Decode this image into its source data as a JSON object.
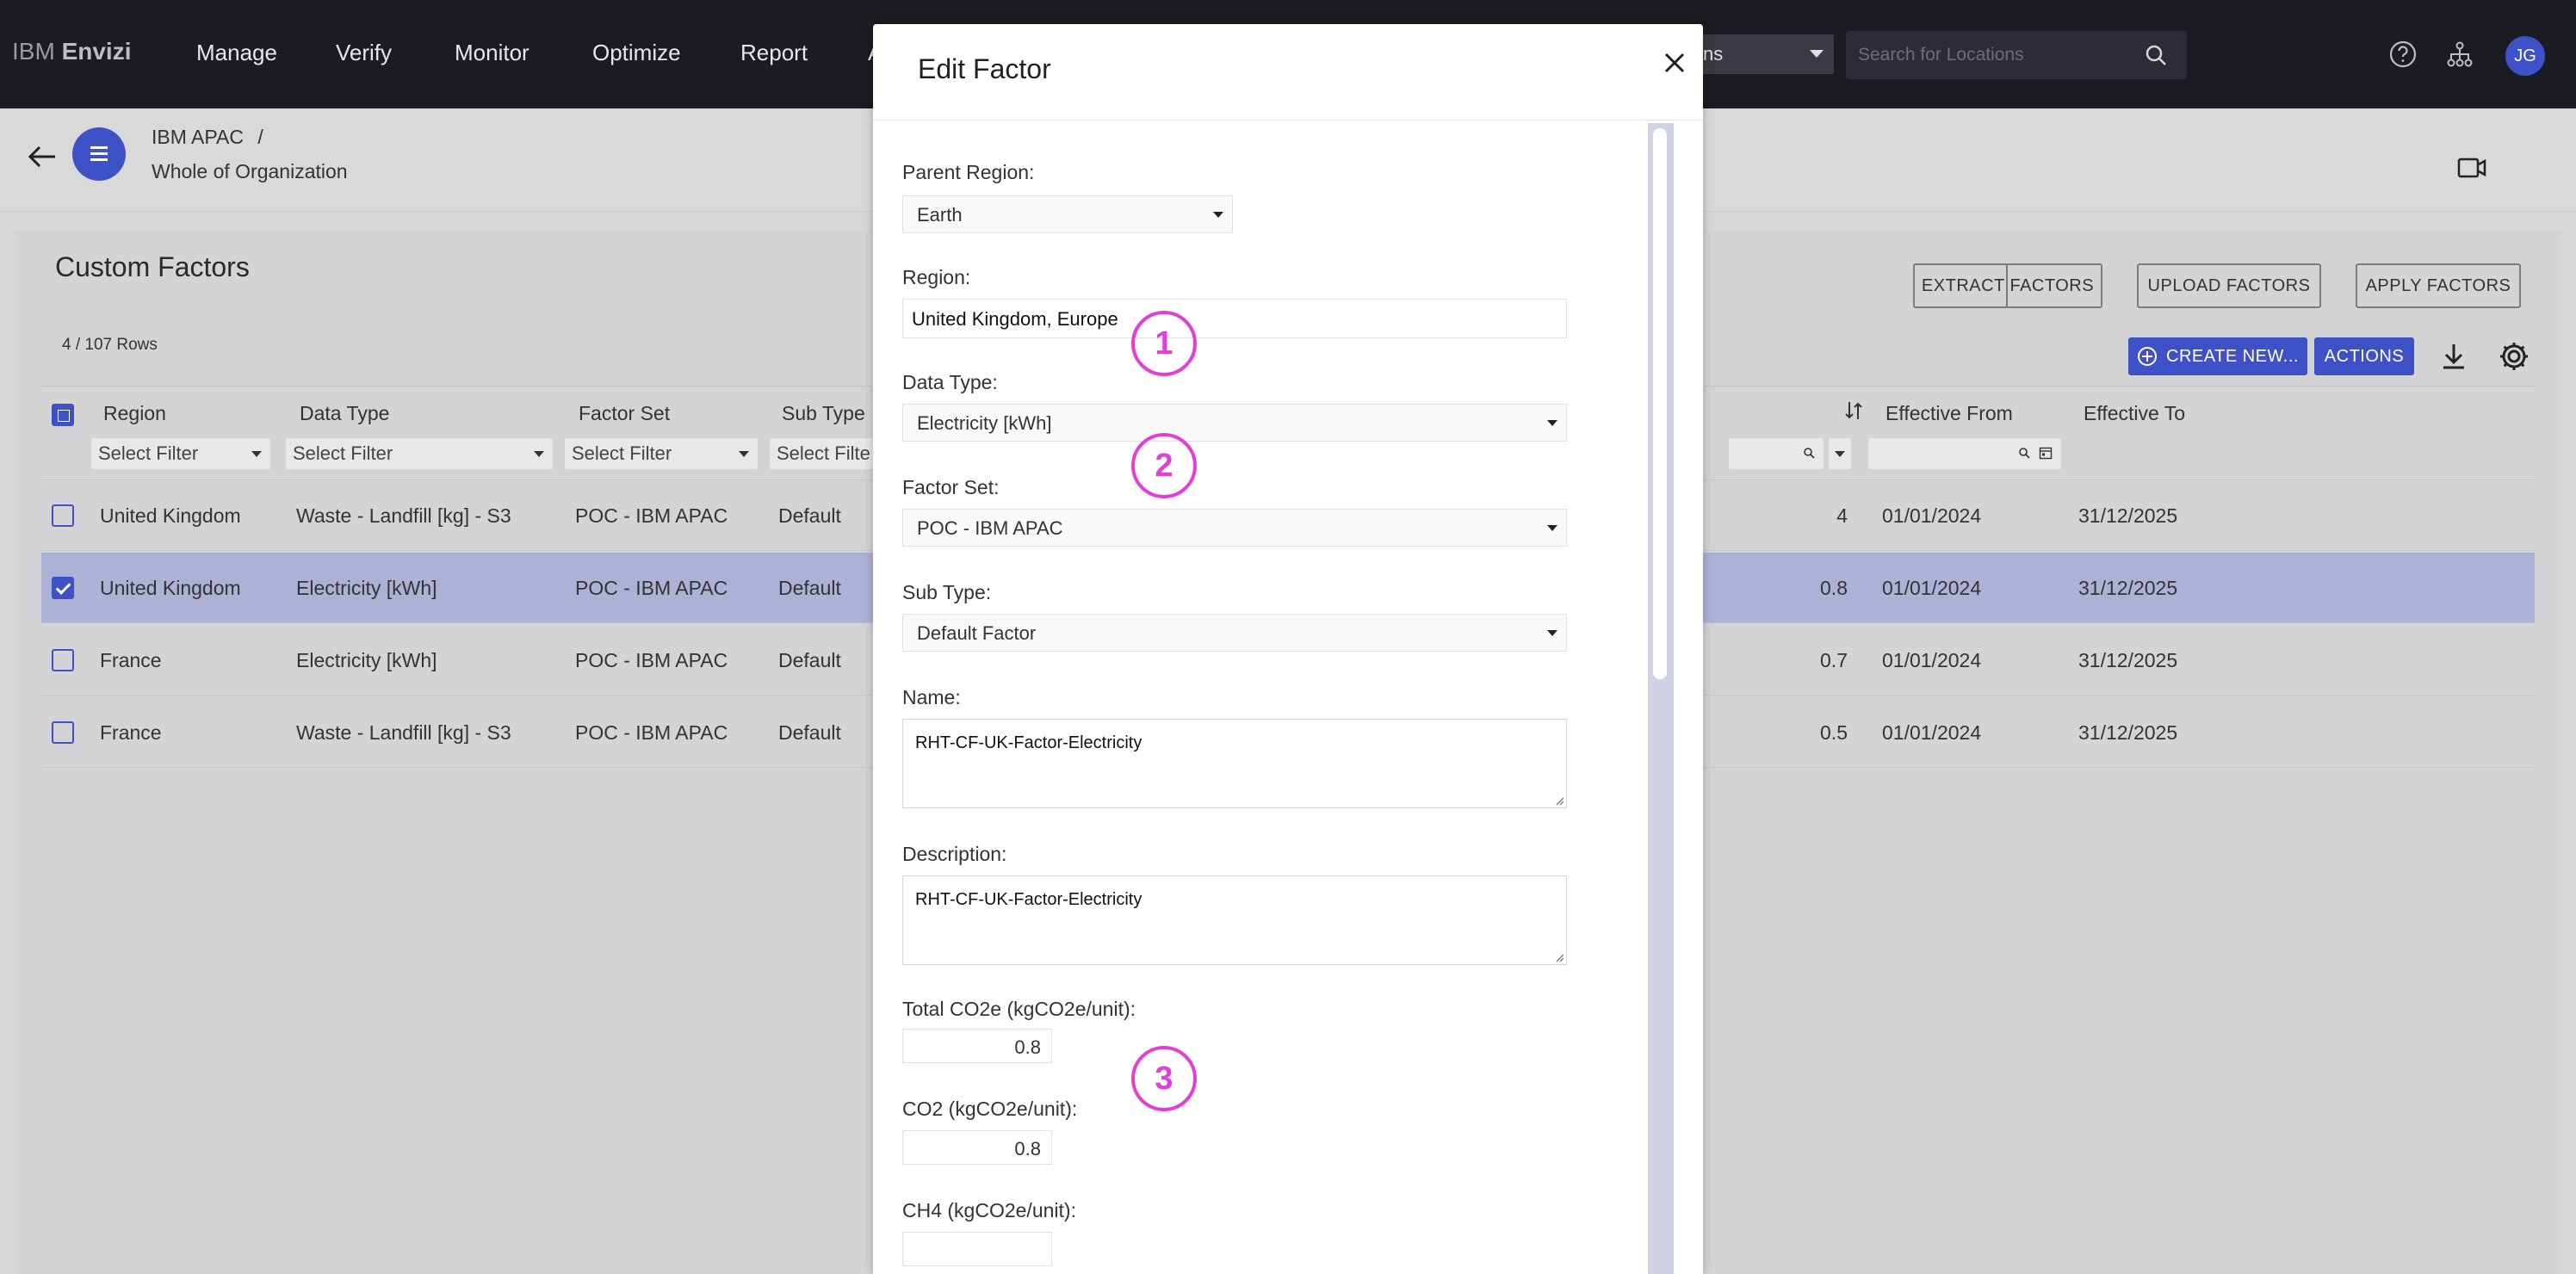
{
  "nav": {
    "brand_prefix": "IBM",
    "brand_name": "Envizi",
    "items": [
      "Manage",
      "Verify",
      "Monitor",
      "Optimize",
      "Report",
      "A"
    ],
    "location_select": "ns",
    "search_placeholder": "Search for Locations",
    "avatar_initials": "JG"
  },
  "breadcrumb": {
    "org": "IBM APAC",
    "separator": "/",
    "scope": "Whole of Organization"
  },
  "page": {
    "title": "Custom Factors",
    "rows_count": "4 / 107 Rows",
    "buttons": {
      "extract": "EXTRACT FACTORS",
      "upload": "UPLOAD FACTORS",
      "apply": "APPLY FACTORS",
      "create_new": "CREATE NEW...",
      "actions": "ACTIONS"
    }
  },
  "table": {
    "columns": [
      "Region",
      "Data Type",
      "Factor Set",
      "Sub Type",
      "Effective From",
      "Effective To"
    ],
    "filter_placeholder": "Select Filter",
    "filter_short": "Select Filte",
    "rows": [
      {
        "region": "United Kingdom",
        "data_type": "Waste - Landfill [kg] - S3",
        "factor_set": "POC - IBM APAC",
        "sub_type": "Default",
        "value": "4",
        "from": "01/01/2024",
        "to": "31/12/2025",
        "checked": false
      },
      {
        "region": "United Kingdom",
        "data_type": "Electricity [kWh]",
        "factor_set": "POC - IBM APAC",
        "sub_type": "Default",
        "value": "0.8",
        "from": "01/01/2024",
        "to": "31/12/2025",
        "checked": true
      },
      {
        "region": "France",
        "data_type": "Electricity [kWh]",
        "factor_set": "POC - IBM APAC",
        "sub_type": "Default",
        "value": "0.7",
        "from": "01/01/2024",
        "to": "31/12/2025",
        "checked": false
      },
      {
        "region": "France",
        "data_type": "Waste - Landfill [kg] - S3",
        "factor_set": "POC - IBM APAC",
        "sub_type": "Default",
        "value": "0.5",
        "from": "01/01/2024",
        "to": "31/12/2025",
        "checked": false
      }
    ]
  },
  "modal": {
    "title": "Edit Factor",
    "fields": {
      "parent_region_label": "Parent Region:",
      "parent_region_value": "Earth",
      "region_label": "Region:",
      "region_value": "United Kingdom, Europe",
      "data_type_label": "Data Type:",
      "data_type_value": "Electricity [kWh]",
      "factor_set_label": "Factor Set:",
      "factor_set_value": "POC - IBM APAC",
      "sub_type_label": "Sub Type:",
      "sub_type_value": "Default Factor",
      "name_label": "Name:",
      "name_value": "RHT-CF-UK-Factor-Electricity",
      "description_label": "Description:",
      "description_value": "RHT-CF-UK-Factor-Electricity",
      "total_co2e_label": "Total CO2e (kgCO2e/unit):",
      "total_co2e_value": "0.8",
      "co2_label": "CO2 (kgCO2e/unit):",
      "co2_value": "0.8",
      "ch4_label": "CH4 (kgCO2e/unit):",
      "ch4_value": ""
    },
    "callouts": [
      "1",
      "2",
      "3"
    ]
  },
  "colors": {
    "accent": "#3f51c6",
    "nav_bg": "#1b1c22",
    "selected_row": "#aeb1d6",
    "callout": "#e33fd6"
  }
}
